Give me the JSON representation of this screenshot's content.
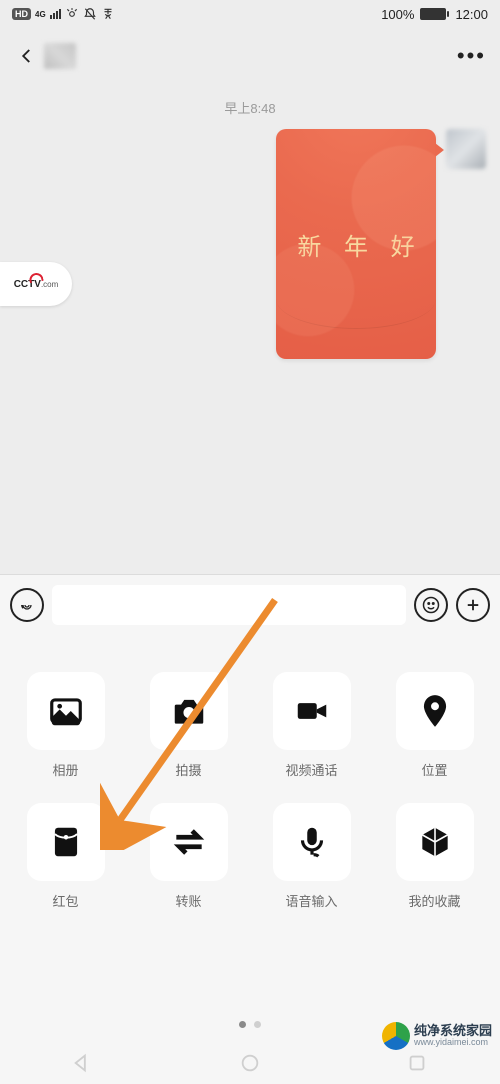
{
  "statusbar": {
    "battery": "100%",
    "time": "12:00",
    "net": "4G",
    "hd": "HD"
  },
  "chat": {
    "timestamp": "早上8:48",
    "redpacket_text": "新 年 好",
    "side_bubble": {
      "brand": "CCTV",
      "suffix": ".com"
    }
  },
  "inputbar": {
    "placeholder": ""
  },
  "panel": {
    "tools": [
      {
        "key": "album",
        "label": "相册"
      },
      {
        "key": "camera",
        "label": "拍摄"
      },
      {
        "key": "video",
        "label": "视频通话"
      },
      {
        "key": "location",
        "label": "位置"
      },
      {
        "key": "redpack",
        "label": "红包"
      },
      {
        "key": "transfer",
        "label": "转账"
      },
      {
        "key": "voice",
        "label": "语音输入"
      },
      {
        "key": "fav",
        "label": "我的收藏"
      }
    ]
  },
  "watermark": {
    "title": "纯净系统家园",
    "url": "www.yidaimei.com"
  }
}
